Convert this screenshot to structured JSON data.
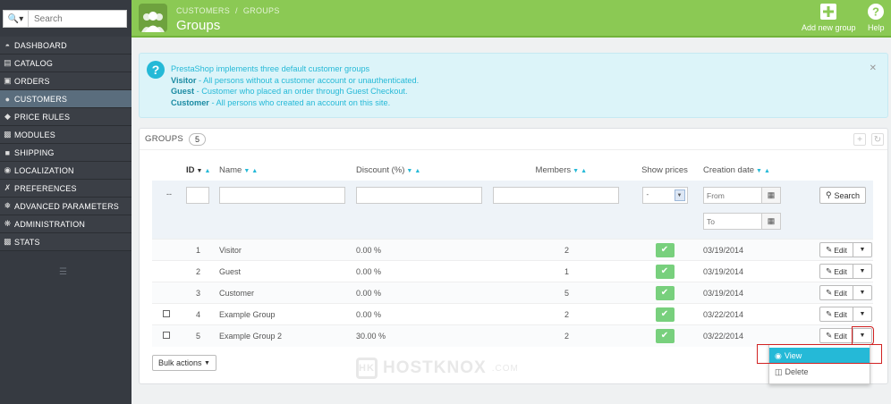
{
  "search": {
    "placeholder": "Search"
  },
  "menu": [
    {
      "label": "DASHBOARD",
      "icon": "dashboard-icon"
    },
    {
      "label": "CATALOG",
      "icon": "catalog-icon"
    },
    {
      "label": "ORDERS",
      "icon": "orders-icon"
    },
    {
      "label": "CUSTOMERS",
      "icon": "customers-icon",
      "active": true
    },
    {
      "label": "PRICE RULES",
      "icon": "tag-icon"
    },
    {
      "label": "MODULES",
      "icon": "puzzle-icon"
    },
    {
      "label": "SHIPPING",
      "icon": "truck-icon"
    },
    {
      "label": "LOCALIZATION",
      "icon": "globe-icon"
    },
    {
      "label": "PREFERENCES",
      "icon": "wrench-icon"
    },
    {
      "label": "ADVANCED PARAMETERS",
      "icon": "cogs-icon"
    },
    {
      "label": "ADMINISTRATION",
      "icon": "gear-icon"
    },
    {
      "label": "STATS",
      "icon": "bar-chart-icon"
    }
  ],
  "header": {
    "breadcrumb": [
      "CUSTOMERS",
      "GROUPS"
    ],
    "title": "Groups",
    "add_label": "Add new group",
    "help_label": "Help"
  },
  "alert": {
    "intro": "PrestaShop implements three default customer groups",
    "lines": [
      {
        "term": "Visitor",
        "desc": " - All persons without a customer account or unauthenticated."
      },
      {
        "term": "Guest",
        "desc": " - Customer who placed an order through Guest Checkout."
      },
      {
        "term": "Customer",
        "desc": " - All persons who created an account on this site."
      }
    ]
  },
  "panel": {
    "title": "GROUPS",
    "count": "5",
    "columns": {
      "id": "ID",
      "name": "Name",
      "discount": "Discount (%)",
      "members": "Members",
      "show_prices": "Show prices",
      "creation_date": "Creation date"
    },
    "filter": {
      "placeholder_dash": "--",
      "show_prices_value": "-",
      "from_placeholder": "From",
      "to_placeholder": "To",
      "search_label": "Search"
    },
    "rows": [
      {
        "id": "1",
        "name": "Visitor",
        "discount": "0.00 %",
        "members": "2",
        "date": "03/19/2014",
        "checkbox": false
      },
      {
        "id": "2",
        "name": "Guest",
        "discount": "0.00 %",
        "members": "1",
        "date": "03/19/2014",
        "checkbox": false
      },
      {
        "id": "3",
        "name": "Customer",
        "discount": "0.00 %",
        "members": "5",
        "date": "03/19/2014",
        "checkbox": false
      },
      {
        "id": "4",
        "name": "Example Group",
        "discount": "0.00 %",
        "members": "2",
        "date": "03/22/2014",
        "checkbox": true
      },
      {
        "id": "5",
        "name": "Example Group 2",
        "discount": "30.00 %",
        "members": "2",
        "date": "03/22/2014",
        "checkbox": true
      }
    ],
    "edit_label": "Edit",
    "bulk_label": "Bulk actions"
  },
  "dropdown": {
    "view_label": "View",
    "delete_label": "Delete"
  },
  "watermark": {
    "text": "HOSTKNOX",
    "suffix": ".COM",
    "logo": "HK"
  },
  "colors": {
    "accent": "#25b9d7",
    "header_green": "#8bc954",
    "sidebar": "#363a41",
    "success": "#78d07d",
    "highlight": "#d12222"
  }
}
